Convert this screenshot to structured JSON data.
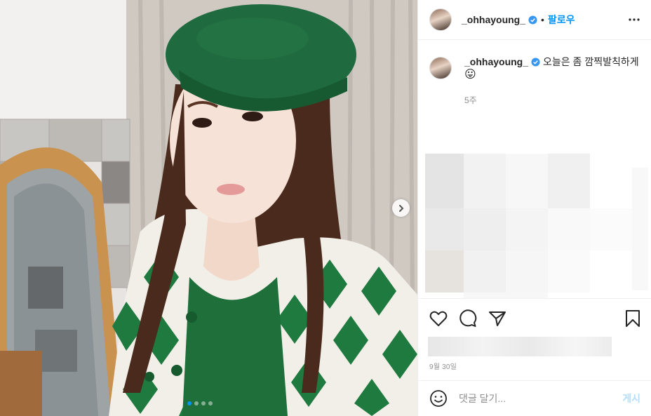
{
  "post": {
    "username": "_ohhayoung_",
    "verified": true,
    "follow_label": "팔로우",
    "separator": "•",
    "caption": "오늘은 좀 깜찍발칙하게",
    "caption_emoji": "😛",
    "time_ago": "5주",
    "date": "9월 30일"
  },
  "carousel": {
    "slide_count": 4,
    "active_index": 0
  },
  "comment_form": {
    "placeholder": "댓글 달기...",
    "post_label": "게시"
  },
  "icons": {
    "more": "more-options-icon",
    "next": "chevron-right-icon",
    "like": "heart-icon",
    "comment": "comment-icon",
    "share": "share-icon",
    "save": "bookmark-icon",
    "emoji": "smiley-icon",
    "verified": "verified-badge-icon"
  },
  "colors": {
    "accent": "#0095f6",
    "text": "#262626",
    "muted": "#8e8e8e",
    "post_disabled": "#b2dffc"
  }
}
